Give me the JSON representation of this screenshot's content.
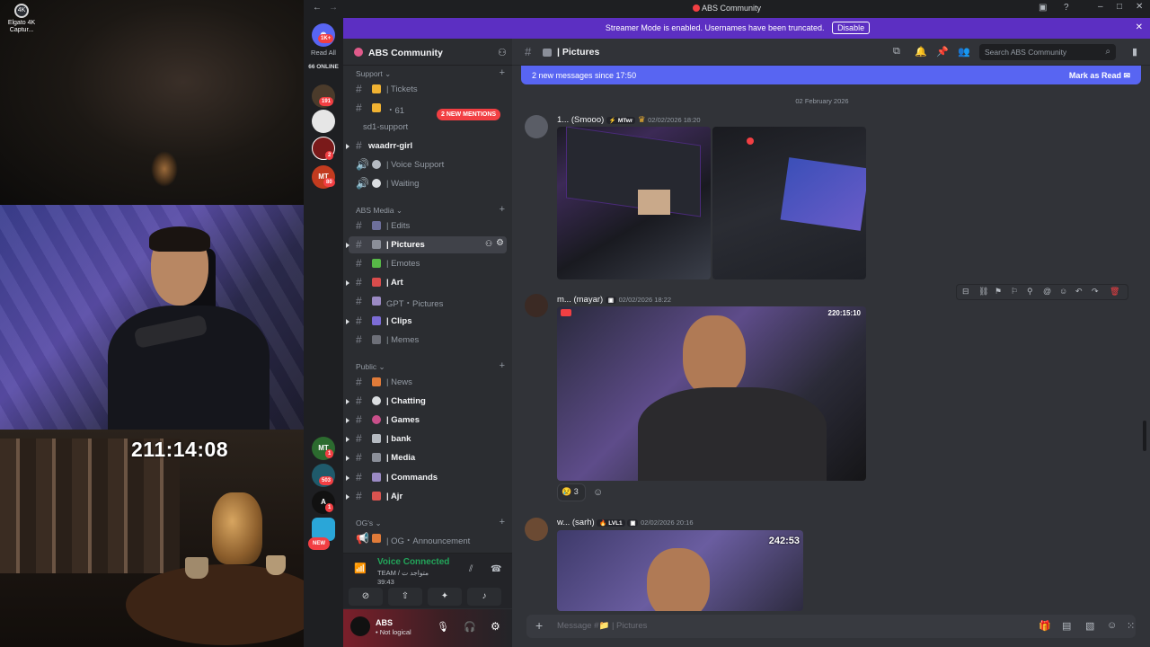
{
  "desktop": {
    "icon_label": "Elgato 4K Captur..."
  },
  "stream": {
    "timer": "211:14:08"
  },
  "window": {
    "title": "ABS Community"
  },
  "banner": {
    "text": "Streamer Mode is enabled. Usernames have been truncated.",
    "button": "Disable"
  },
  "guilds": {
    "read_all": "Read All",
    "online": "66 ONLINE",
    "top_badge": "1K+",
    "items": [
      {
        "label": "",
        "badge": "191"
      },
      {
        "label": "",
        "badge": ""
      },
      {
        "label": "",
        "badge": "2"
      },
      {
        "label": "MT",
        "badge": "80"
      },
      {
        "label": "MT",
        "badge": "1"
      },
      {
        "label": "",
        "badge": "503"
      },
      {
        "label": "A",
        "badge": "1"
      },
      {
        "label": "",
        "badge": "NEW"
      }
    ]
  },
  "server": {
    "name": "ABS Community"
  },
  "mentions_pill": "2 NEW MENTIONS",
  "categories": {
    "support": "Support",
    "media": "ABS Media",
    "public": "Public",
    "ogs": "OG's"
  },
  "channels": {
    "support": [
      {
        "name": "| Tickets",
        "emoji": "ticket"
      },
      {
        "name": "・61",
        "emoji": "ticket"
      },
      {
        "name": "sd1-support",
        "emoji": ""
      },
      {
        "name": "waadrr-girl",
        "emoji": ""
      },
      {
        "name": "| Voice Support",
        "emoji": "speaker"
      },
      {
        "name": "| Waiting",
        "emoji": "clock"
      }
    ],
    "media": [
      {
        "name": "| Edits",
        "emoji": "camera"
      },
      {
        "name": "| Pictures",
        "emoji": "folder"
      },
      {
        "name": "| Emotes",
        "emoji": "sparkle"
      },
      {
        "name": "| Art",
        "emoji": "brush"
      },
      {
        "name": "GPT・Pictures",
        "emoji": "robot"
      },
      {
        "name": "| Clips",
        "emoji": "film"
      },
      {
        "name": "| Memes",
        "emoji": "frame"
      }
    ],
    "public": [
      {
        "name": "| News",
        "emoji": "megaphone"
      },
      {
        "name": "| Chatting",
        "emoji": "speech"
      },
      {
        "name": "| Games",
        "emoji": "game"
      },
      {
        "name": "| bank",
        "emoji": "bank"
      },
      {
        "name": "| Media",
        "emoji": "folder"
      },
      {
        "name": "| Commands",
        "emoji": "robot"
      },
      {
        "name": "| Ajr",
        "emoji": "chart"
      }
    ],
    "ogs": [
      {
        "name": "| OG・Announcement",
        "emoji": "megaphone"
      }
    ]
  },
  "voice": {
    "title": "Voice Connected",
    "subtitle": "TEAM / متواجد ت",
    "time": "39:43"
  },
  "user": {
    "name": "ABS",
    "status": "• Not logical"
  },
  "chat": {
    "channel": "| Pictures",
    "search_placeholder": "Search ABS Community",
    "new_messages": "2 new messages since 17:50",
    "mark_read": "Mark as Read",
    "date_divider": "02 February 2026",
    "messages": [
      {
        "author": "1... (Smooo)",
        "tag": "MTwr",
        "time": "02/02/2026 18:20"
      },
      {
        "author": "m... (mayar)",
        "tag": "",
        "time": "02/02/2026 18:22",
        "overlay": "220:15:10",
        "reaction_count": "3"
      },
      {
        "author": "w... (sarh)",
        "tag": "LVL1",
        "time": "02/02/2026 20:16",
        "overlay": "242:53"
      }
    ],
    "composer_placeholder": "Message #📁 | Pictures"
  },
  "colors": {
    "brand": "#5865f2",
    "banner": "#5c2fc2",
    "online": "#23a55a",
    "badge": "#f23f43"
  }
}
